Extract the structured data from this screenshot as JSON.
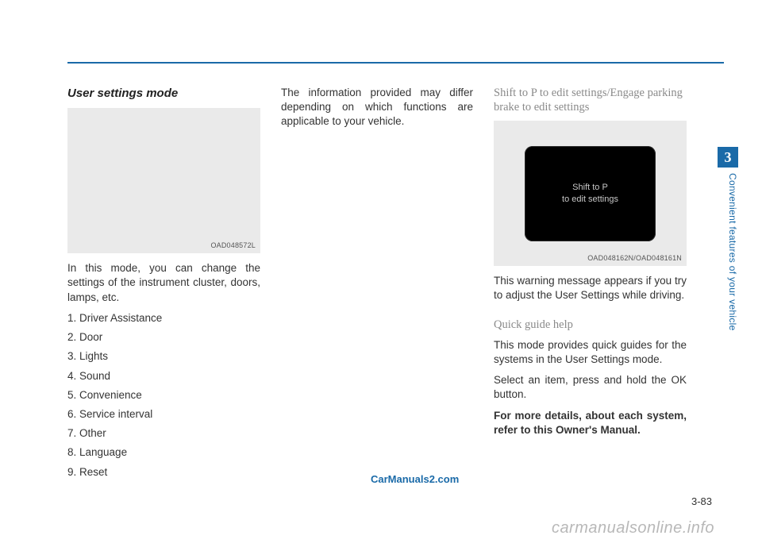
{
  "sideTab": {
    "number": "3",
    "label": "Convenient features of your vehicle"
  },
  "col1": {
    "heading": "User settings mode",
    "figCaption": "OAD048572L",
    "intro": "In this mode, you can change the settings of the instrument cluster, doors, lamps, etc.",
    "items": [
      "1. Driver Assistance",
      "2. Door",
      "3. Lights",
      "4. Sound",
      "5. Convenience",
      "6. Service interval",
      "7. Other",
      "8. Language",
      "9. Reset"
    ]
  },
  "col2": {
    "para": "The information provided may differ depending on which functions are applicable to your vehicle."
  },
  "col3": {
    "sectionA": {
      "heading": "Shift to P to edit settings/Engage parking brake to edit settings",
      "screenLine1": "Shift to P",
      "screenLine2": "to edit settings",
      "figCaption": "OAD048162N/OAD048161N",
      "para": "This warning message appears if you try to adjust the User Settings while driving."
    },
    "sectionB": {
      "heading": "Quick guide help",
      "p1": "This mode provides quick guides for the systems in the User Settings mode.",
      "p2": "Select an item, press and hold the OK button.",
      "p3": "For more details, about each system, refer to this Owner's Manual."
    }
  },
  "watermarkLink": "CarManuals2.com",
  "pageNumber": "3-83",
  "bottomWatermark": "carmanualsonline.info"
}
